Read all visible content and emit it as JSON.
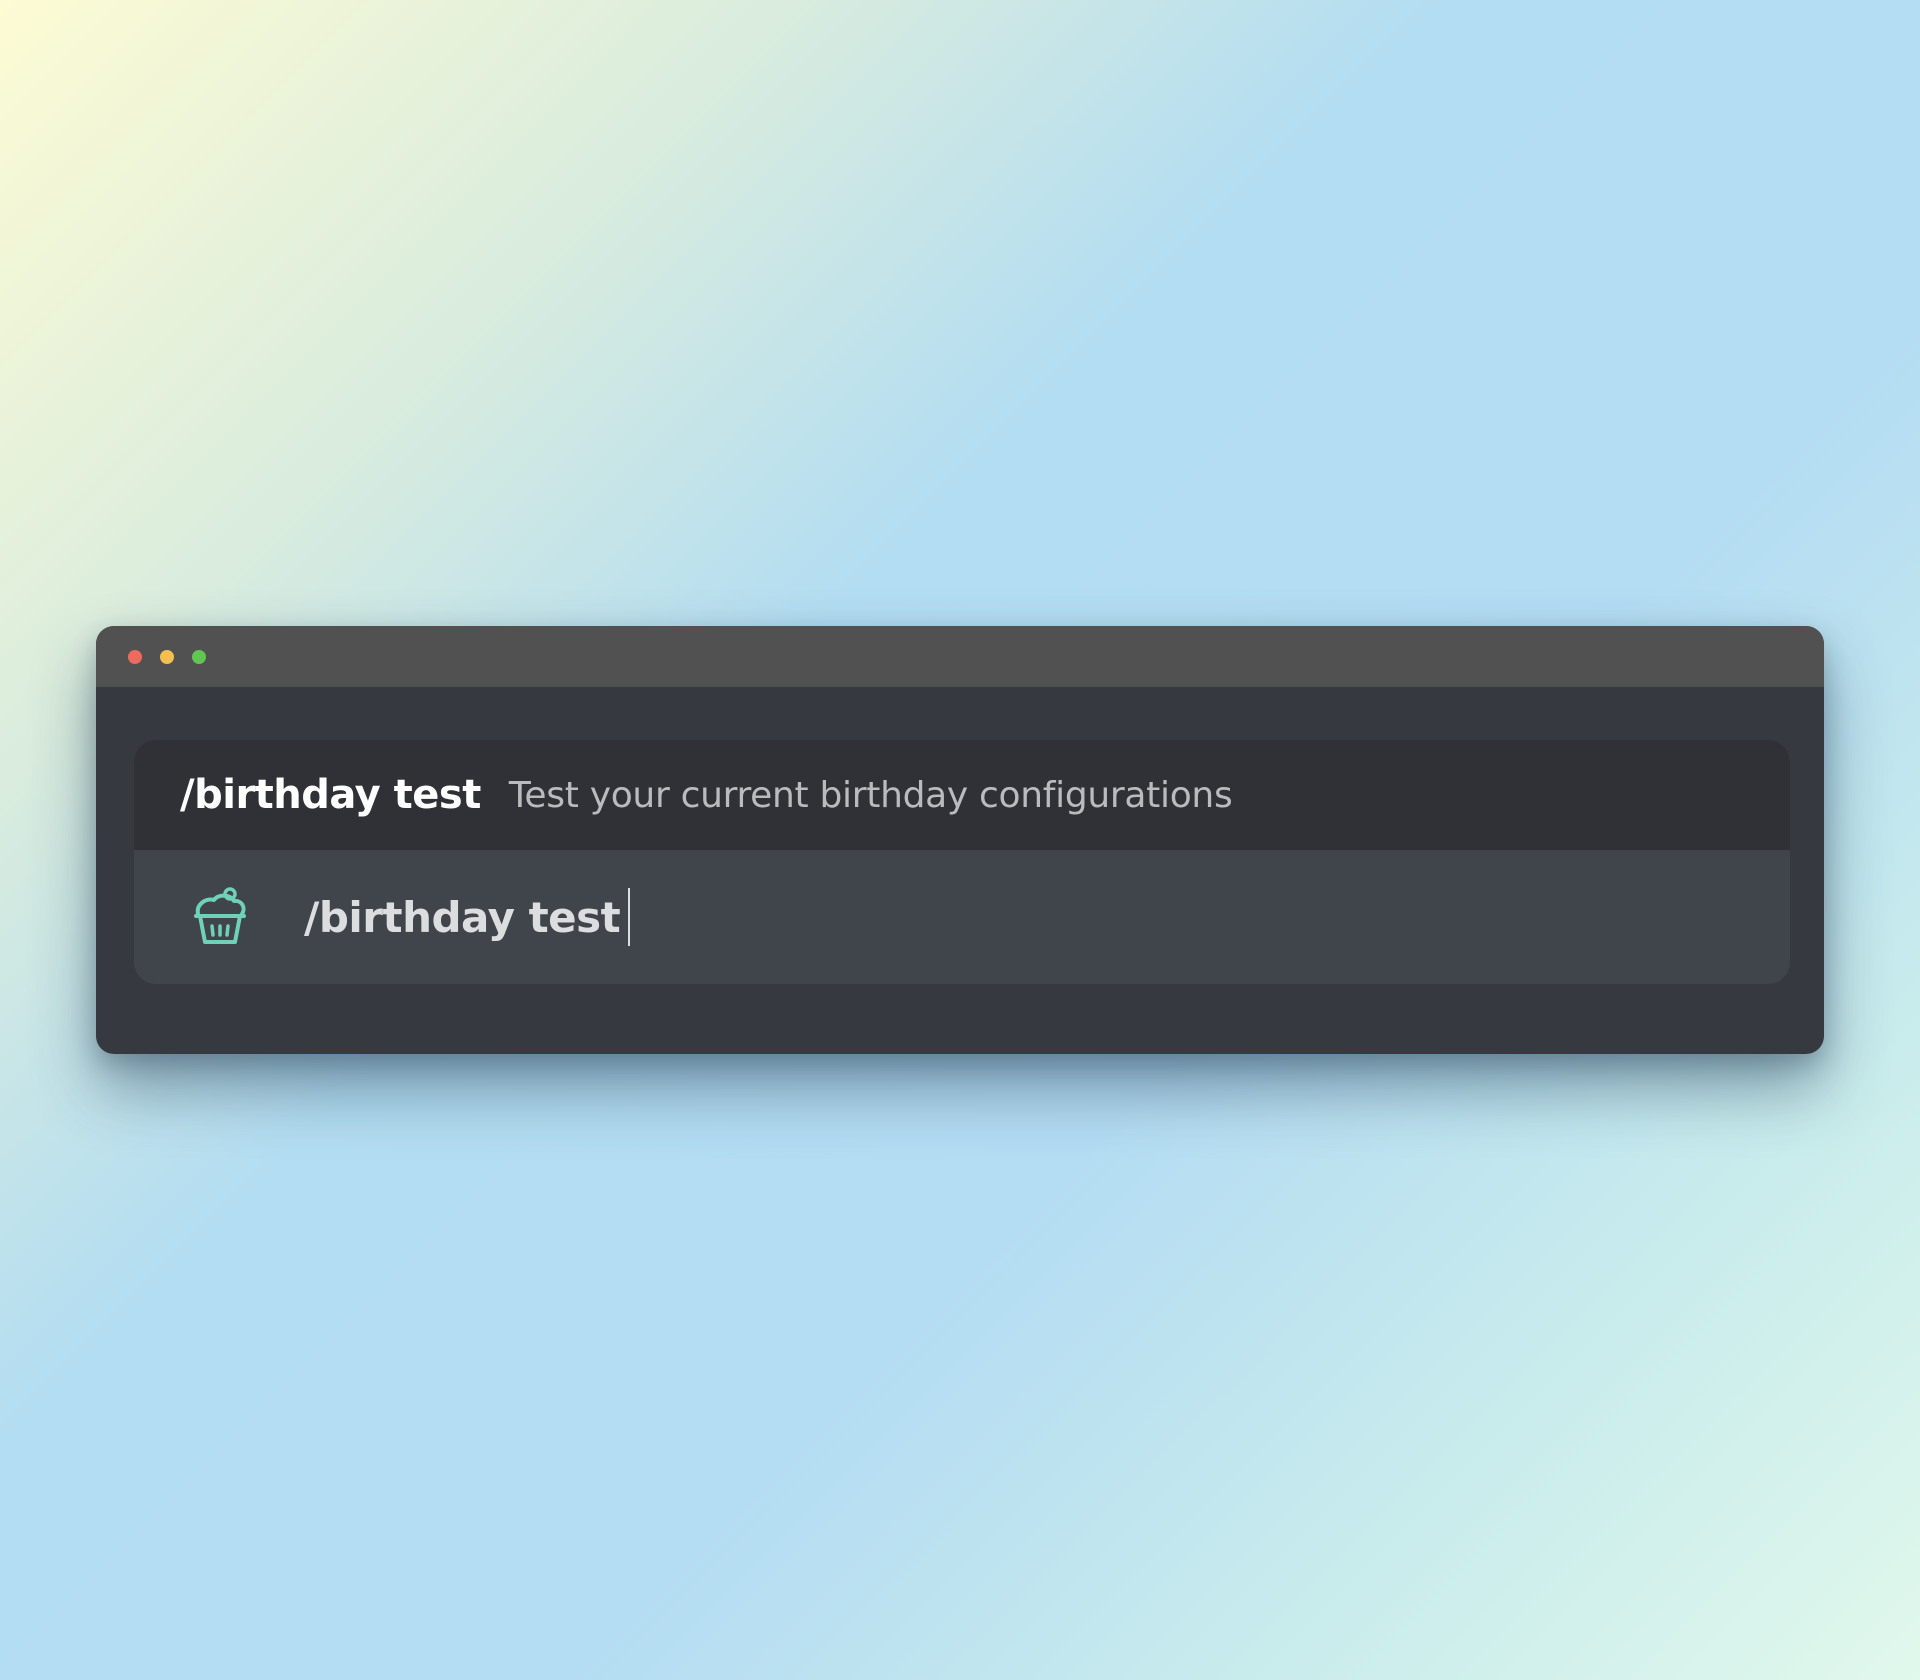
{
  "window": {
    "controls": {
      "close_color": "#ed6a5e",
      "minimize_color": "#f5bf4f",
      "zoom_color": "#61c554"
    }
  },
  "autocomplete": {
    "command": "/birthday test",
    "description": "Test your current birthday configurations"
  },
  "message_input": {
    "bot_icon": "cupcake-icon",
    "accent_color": "#6fd1b8",
    "value": "/birthday test"
  }
}
